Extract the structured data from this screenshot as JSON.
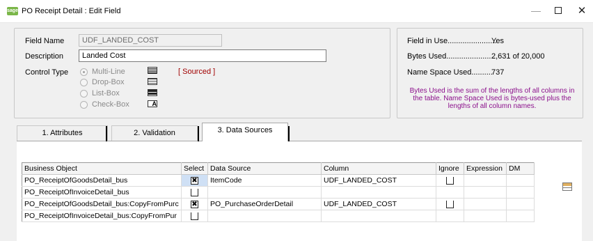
{
  "window": {
    "icon_text": "sage",
    "title": "PO Receipt Detail : Edit  Field",
    "minimize": "—",
    "close": "✕"
  },
  "field_info": {
    "field_name_label": "Field Name",
    "field_name_value": "UDF_LANDED_COST",
    "description_label": "Description",
    "description_value": "Landed Cost",
    "control_type_label": "Control Type",
    "control_types": [
      {
        "label": "Multi-Line",
        "selected": true
      },
      {
        "label": "Drop-Box",
        "selected": false
      },
      {
        "label": "List-Box",
        "selected": false
      },
      {
        "label": "Check-Box",
        "selected": false
      }
    ],
    "sourced_tag": "[ Sourced ]",
    "checkbox_icon_glyph": "A"
  },
  "usage": {
    "field_in_use_label": "Field in Use.......................",
    "field_in_use_value": "Yes",
    "bytes_used_label": "Bytes Used.......................",
    "bytes_used_value": "2,631 of 20,000",
    "name_space_label": "Name Space Used..........",
    "name_space_value": "737",
    "note": "Bytes Used is the sum of the lengths of all columns in the table.  Name Space Used is bytes-used plus the lengths of all column names."
  },
  "tabs": [
    {
      "label": "1. Attributes",
      "active": false
    },
    {
      "label": "2. Validation",
      "active": false
    },
    {
      "label": "3. Data Sources",
      "active": true
    }
  ],
  "grid": {
    "columns": [
      "Business Object",
      "Select",
      "Data Source",
      "Column",
      "Ignore",
      "Expression",
      "DM"
    ],
    "rows": [
      {
        "business_object": "PO_ReceiptOfGoodsDetail_bus",
        "select": "checked",
        "data_source": "ItemCode",
        "column": "UDF_LANDED_COST",
        "ignore": "unchecked",
        "expression": "",
        "dm": ""
      },
      {
        "business_object": "PO_ReceiptOfInvoiceDetail_bus",
        "select": "unchecked",
        "data_source": "",
        "column": "",
        "ignore": "",
        "expression": "",
        "dm": ""
      },
      {
        "business_object": "PO_ReceiptOfGoodsDetail_bus:CopyFromPurc",
        "select": "checked",
        "data_source": "PO_PurchaseOrderDetail",
        "column": "UDF_LANDED_COST",
        "ignore": "unchecked",
        "expression": "",
        "dm": ""
      },
      {
        "business_object": "PO_ReceiptOfInvoiceDetail_bus:CopyFromPur",
        "select": "unchecked",
        "data_source": "",
        "column": "",
        "ignore": "",
        "expression": "",
        "dm": ""
      }
    ],
    "check_glyph": "✖"
  },
  "side_tool_icon": "data-source-icon"
}
